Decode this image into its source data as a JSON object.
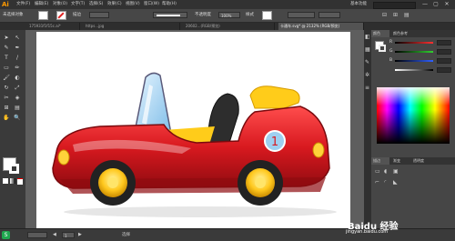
{
  "app": {
    "logo": "Ai",
    "menu": [
      "文件(F)",
      "编辑(E)",
      "对象(O)",
      "文字(T)",
      "选择(S)",
      "效果(C)",
      "视图(V)",
      "窗口(W)",
      "帮助(H)"
    ],
    "workspace_label": "基本功能",
    "search_placeholder": "",
    "window_controls": [
      "—",
      "▢",
      "✕"
    ]
  },
  "control_bar": {
    "object_label": "未选择对象",
    "stroke_label": "描边",
    "stroke_value": "",
    "brush_label": "",
    "style_label": "不透明度",
    "opacity_value": "100%",
    "style_text": "样式",
    "doc_setup_btn": "",
    "prefs_btn": ""
  },
  "tabs": [
    {
      "label": "175931f1f15c.ai*",
      "active": false
    },
    {
      "label": "https...jpg",
      "active": false
    },
    {
      "label": "20602...(RGB/预览)",
      "active": false
    },
    {
      "label": "卡通车.svg* @ 2132% (RGB/预览)",
      "active": true
    }
  ],
  "tools": [
    "➤",
    "↖",
    "✎",
    "✒",
    "T",
    "/",
    "▭",
    "✏",
    "🖌",
    "◐",
    "↻",
    "⤢",
    "✂",
    "◈",
    "⊞",
    "▤",
    "✋",
    "🔍"
  ],
  "color_panel": {
    "tabs": [
      "颜色",
      "颜色参考"
    ],
    "sliders": [
      {
        "label": "R",
        "value": "",
        "color": "#ff4040"
      },
      {
        "label": "G",
        "value": "",
        "color": "#40c040"
      },
      {
        "label": "B",
        "value": "",
        "color": "#4060ff"
      },
      {
        "label": "",
        "value": "",
        "color": "#cccccc"
      }
    ]
  },
  "bottom_panel": {
    "tabs": [
      "描边",
      "渐变",
      "透明度"
    ]
  },
  "status": {
    "zoom": "",
    "artboard_page": "1",
    "mode": "选择"
  },
  "watermark": {
    "text": "Baidu 经验",
    "url": "jingyan.baidu.com"
  },
  "colors": {
    "car_body": "#d8191f",
    "car_highlight": "#ff4a4a",
    "wheel": "#222222",
    "rim": "#ffc81e",
    "seat": "#2d2d2d",
    "windshield": "#a9d5f2",
    "number_circle": "#9ed0f0",
    "number_text": "#d8191f"
  },
  "car": {
    "number": "1"
  }
}
